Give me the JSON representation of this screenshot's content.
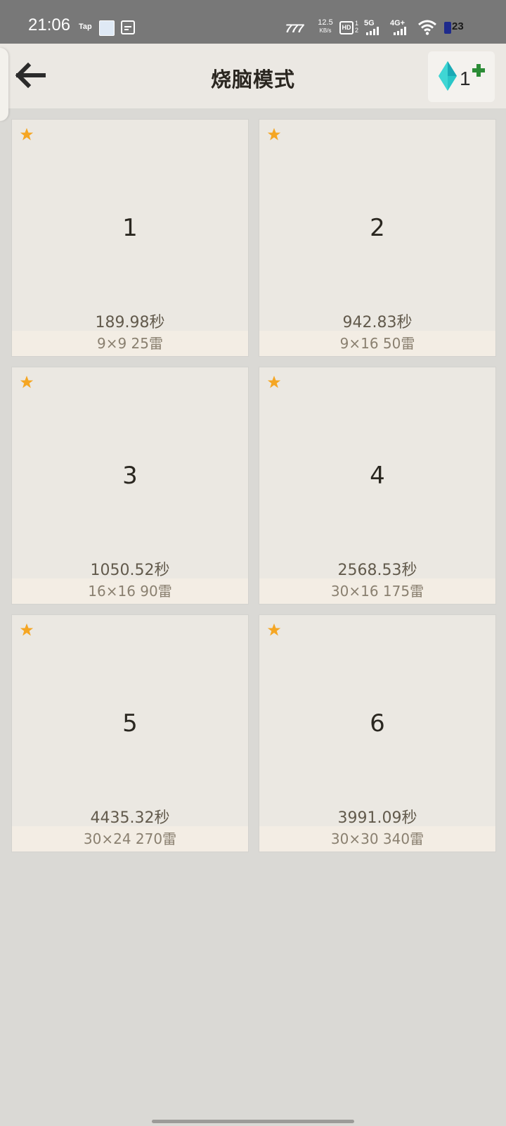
{
  "status_bar": {
    "time": "21:06",
    "tap_label": "Tap",
    "logo_label": "777",
    "speed_value": "12.5",
    "speed_unit": "KB/s",
    "hd_label": "HD",
    "hd_nums": "1\n2",
    "net1": "5G",
    "net2": "4G+",
    "battery": "23"
  },
  "header": {
    "title": "烧脑模式",
    "gem_count": "1"
  },
  "levels": [
    {
      "number": "1",
      "time": "189.98秒",
      "info": "9×9  25雷"
    },
    {
      "number": "2",
      "time": "942.83秒",
      "info": "9×16  50雷"
    },
    {
      "number": "3",
      "time": "1050.52秒",
      "info": "16×16  90雷"
    },
    {
      "number": "4",
      "time": "2568.53秒",
      "info": "30×16  175雷"
    },
    {
      "number": "5",
      "time": "4435.32秒",
      "info": "30×24  270雷"
    },
    {
      "number": "6",
      "time": "3991.09秒",
      "info": "30×30  340雷"
    }
  ],
  "colors": {
    "star": "#f5a623",
    "gem": "#29c6c7",
    "plus": "#2b8c36"
  },
  "icons": {
    "back": "arrow-left-icon",
    "gem": "diamond-gem-icon",
    "plus": "plus-icon",
    "star": "star-icon"
  }
}
